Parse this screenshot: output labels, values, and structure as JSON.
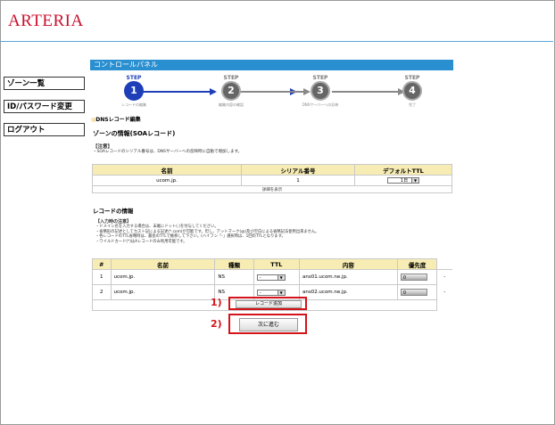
{
  "brand": {
    "logo": "ARTERIA"
  },
  "sidebar": {
    "items": [
      {
        "label": "ゾーン一覧"
      },
      {
        "label": "ID/パスワード変更"
      },
      {
        "label": "ログアウト"
      }
    ]
  },
  "panel": {
    "title": "コントロールパネル"
  },
  "steps": [
    {
      "label": "STEP",
      "number": "1",
      "caption": "レコードの編集"
    },
    {
      "label": "STEP",
      "number": "2",
      "caption": "編集内容の確認"
    },
    {
      "label": "STEP",
      "number": "3",
      "caption": "DNSサーバーへの反映"
    },
    {
      "label": "STEP",
      "number": "4",
      "caption": "完了"
    }
  ],
  "section": {
    "heading": "DNSレコード編集",
    "zone_heading": "ゾーンの情報(SOAレコード)"
  },
  "notice": {
    "title": "【注意】",
    "text": "・SOAレコードのシリアル番号は、DNSサーバーへの反映時に自動で増加します。"
  },
  "soa_table": {
    "headers": [
      "名前",
      "シリアル番号",
      "デフォルトTTL"
    ],
    "row": {
      "name": "ucom.jp.",
      "serial": "1",
      "ttl": "1日"
    },
    "details_link": "詳細を表示"
  },
  "records": {
    "heading": "レコードの情報",
    "input_notes_title": "【入力時の注意】",
    "input_notes": [
      "・ドメイン名を入力する場合は、末尾にドット(.)を付与してください。",
      "・省略形の記述としてカスト記による記述(*.com)が可能です。但し、アットマーク(@)及び空白による省略記法使用出来ません。",
      "・各レコードのTTL省略時は、最長のTTLで推移して下さい。(ハイフン「-」選択時は、1回のTTLとなります。",
      "・ワイルドカード(*)はAレコードのみ利用可能です。"
    ],
    "headers": [
      "#",
      "名前",
      "種類",
      "TTL",
      "内容",
      "優先度"
    ],
    "rows": [
      {
        "num": "1",
        "name": "ucom.jp.",
        "type": "NS",
        "ttl": "-",
        "content": "ans01.ucom.ne.jp.",
        "priority": "0",
        "action": "-"
      },
      {
        "num": "2",
        "name": "ucom.jp.",
        "type": "NS",
        "ttl": "-",
        "content": "ans02.ucom.ne.jp.",
        "priority": "0",
        "action": "-"
      }
    ],
    "add_button": "レコード追加",
    "next_button": "次に進む"
  },
  "annotations": {
    "first": "1)",
    "second": "2)"
  },
  "colors": {
    "brand": "#c8102e",
    "panel": "#2a8fd0",
    "step_active": "#1e3fb8",
    "highlight": "#d4141a"
  }
}
